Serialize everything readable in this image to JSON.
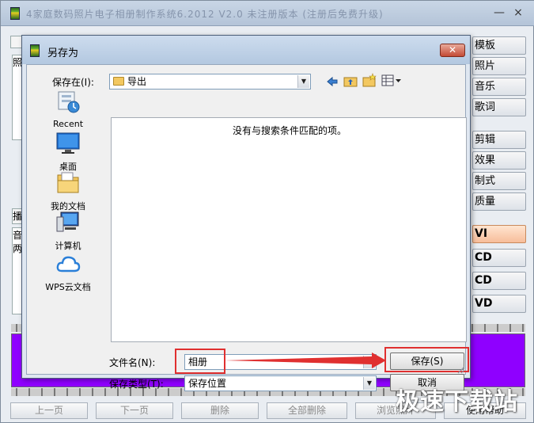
{
  "app": {
    "title": "4家庭数码照片电子相册制作系统6.2012   V2.0   未注册版本   (注册后免费升级)",
    "minimize_glyph": "—",
    "close_glyph": "×",
    "right_buttons": [
      "模板",
      "照片",
      "音乐",
      "歌词",
      "剪辑",
      "效果",
      "制式",
      "质量",
      "VI",
      "CD",
      "CD",
      "VD"
    ],
    "left_stub_chars": [
      "照",
      "播",
      "音",
      "两"
    ],
    "bottom_buttons": [
      "上一页",
      "下一页",
      "删除",
      "全部删除",
      "浏览照片",
      "使用帮助"
    ],
    "accent_color": "#8f00ff"
  },
  "dialog": {
    "title": "另存为",
    "close_glyph": "✕",
    "save_in_label": "保存在(I):",
    "save_in_value": "导出",
    "places": [
      {
        "label": "Recent",
        "icon": "recent-icon"
      },
      {
        "label": "桌面",
        "icon": "desktop-icon"
      },
      {
        "label": "我的文档",
        "icon": "my-documents-icon"
      },
      {
        "label": "计算机",
        "icon": "computer-icon"
      },
      {
        "label": "WPS云文档",
        "icon": "wps-cloud-icon"
      }
    ],
    "empty_message": "没有与搜索条件匹配的项。",
    "filename_label": "文件名(N):",
    "filename_value": "相册",
    "filetype_label": "保存类型(T):",
    "filetype_value": "保存位置",
    "save_button": "保存(S)",
    "cancel_button": "取消",
    "highlight_color": "#e03030"
  },
  "watermark": "极速下载站"
}
